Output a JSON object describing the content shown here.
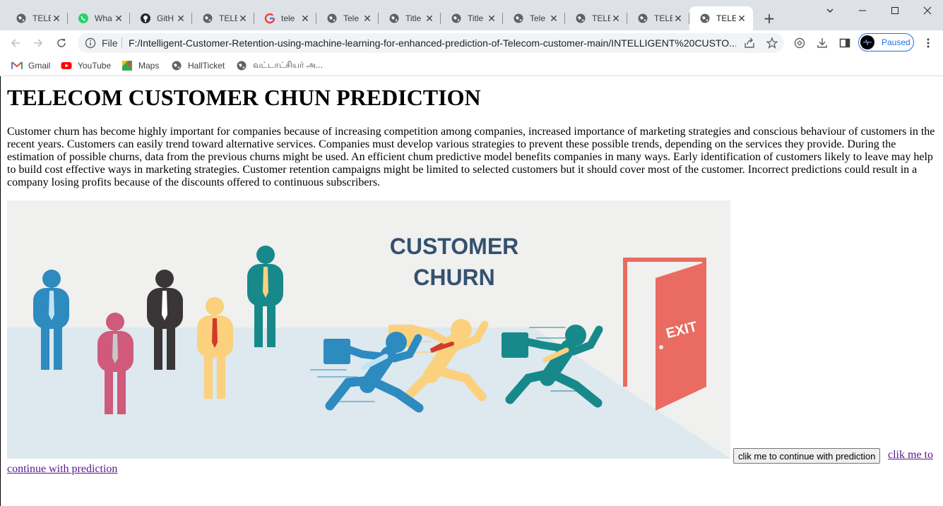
{
  "browser": {
    "tabs": [
      {
        "title": "TELE",
        "icon": "globe-icon",
        "active": false
      },
      {
        "title": "Wha",
        "icon": "whatsapp-icon",
        "active": false
      },
      {
        "title": "GitH",
        "icon": "github-icon",
        "active": false
      },
      {
        "title": "TELE",
        "icon": "globe-icon",
        "active": false
      },
      {
        "title": "tele",
        "icon": "google-icon",
        "active": false
      },
      {
        "title": "Tele",
        "icon": "globe-icon",
        "active": false
      },
      {
        "title": "Title",
        "icon": "globe-icon",
        "active": false
      },
      {
        "title": "Title",
        "icon": "globe-icon",
        "active": false
      },
      {
        "title": "Tele",
        "icon": "globe-icon",
        "active": false
      },
      {
        "title": "TELE",
        "icon": "globe-icon",
        "active": false
      },
      {
        "title": "TELE",
        "icon": "globe-icon",
        "active": false
      },
      {
        "title": "TELE",
        "icon": "globe-icon",
        "active": true
      }
    ],
    "address": {
      "scheme_label": "File",
      "url": "F:/Intelligent-Customer-Retention-using-machine-learning-for-enhanced-prediction-of-Telecom-customer-main/INTELLIGENT%20CUSTO..."
    },
    "profile": {
      "label": "Paused"
    },
    "bookmarks": [
      {
        "label": "Gmail",
        "icon": "gmail-icon"
      },
      {
        "label": "YouTube",
        "icon": "youtube-icon"
      },
      {
        "label": "Maps",
        "icon": "maps-icon"
      },
      {
        "label": "HallTicket",
        "icon": "globe-icon"
      },
      {
        "label": "வட்டாட்சியர் அ...",
        "icon": "globe-icon"
      }
    ]
  },
  "page": {
    "heading": "TELECOM CUSTOMER CHUN PREDICTION",
    "intro": "Customer churn has become highly important for companies because of increasing competition among companies, increased importance of marketing strategies and conscious behaviour of customers in the recent years. Customers can easily trend toward alternative services. Companies must develop various strategies to prevent these possible trends, depending on the services they provide. During the estimation of possible churns, data from the previous churns might be used. An efficient chum predictive model benefits companies in many ways. Early identification of customers likely to leave may help to build cost effective ways in marketing strategies. Customer retention campaigns might be limited to selected customers but it should cover most of the customer. Incorrect predictions could result in a company losing profits because of the discounts offered to continuous subscribers.",
    "hero": {
      "title_line1": "CUSTOMER",
      "title_line2": "CHURN",
      "door_sign": "EXIT",
      "colors": {
        "background": "#f0f0ef",
        "floor": "#dde8ef",
        "navy": "#34516f",
        "blue": "#2d8bbf",
        "pink": "#cf5a7b",
        "dark": "#3a3536",
        "yellow": "#fbd17e",
        "teal": "#17898a",
        "door": "#ea6b61"
      }
    },
    "button_label": "clik me to continue with prediction",
    "link_label_part1": "clik me to",
    "link_label_part2": "continue with prediction"
  }
}
